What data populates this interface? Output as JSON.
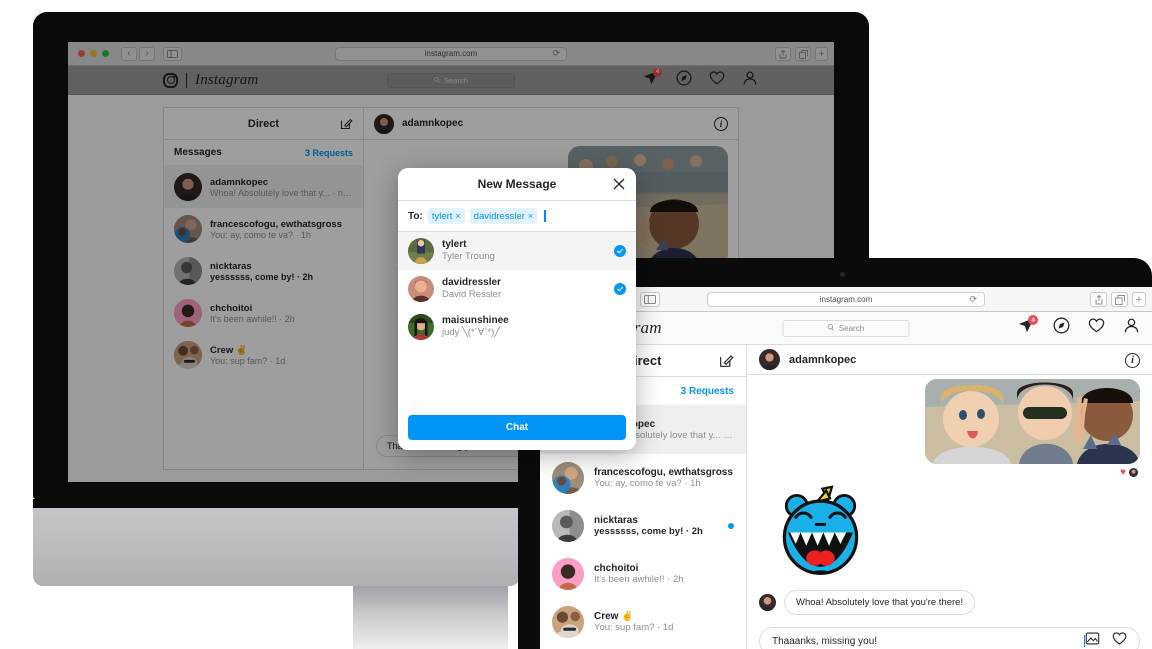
{
  "scene": {
    "description": "Instagram Direct web UI shown on an iMac desktop and a MacBook laptop",
    "accent_blue": "#0095f6",
    "badge_red": "#ed4956",
    "heart_red": "#ed4956"
  },
  "browser": {
    "url": "instagram.com",
    "traffic_lights": [
      "#ff5f57",
      "#febc2e",
      "#28c840"
    ],
    "icons": {
      "back": "‹",
      "forward": "›",
      "sidebar": "sidebar-icon",
      "reload": "⟳",
      "share": "share-icon",
      "tabs": "tabs-icon",
      "newtab": "+"
    }
  },
  "instagram_nav": {
    "wordmark": "Instagram",
    "search_placeholder": "Search",
    "search_icon": "search-icon",
    "notification_badge": "4",
    "icons": {
      "activity": "paper-plane-icon",
      "explore": "compass-icon",
      "likes": "heart-icon",
      "profile": "person-icon"
    }
  },
  "direct": {
    "header_title": "Direct",
    "compose_icon": "compose-icon",
    "messages_label": "Messages",
    "requests_label": "3 Requests",
    "threads": [
      {
        "name": "adamnkopec",
        "preview": "Whoa! Absolutely love that y... · now",
        "active": true,
        "unread": false,
        "avatar_colors": [
          "#3a2f2a",
          "#6b5547"
        ]
      },
      {
        "name": "francescofogu, ewthatsgross",
        "preview": "You: ay, como te va? · 1h",
        "active": false,
        "unread": false,
        "avatar_colors": [
          "#8a7a6a",
          "#2f7fbf"
        ]
      },
      {
        "name": "nicktaras",
        "preview": "yessssss, come by! · 2h",
        "active": false,
        "unread": true,
        "avatar_colors": [
          "#9a9a9a",
          "#4a4a4a"
        ]
      },
      {
        "name": "chchoitoi",
        "preview": "It's been awhile!! · 2h",
        "active": false,
        "unread": false,
        "avatar_colors": [
          "#ff9ec4",
          "#c9547f"
        ]
      },
      {
        "name": "Crew ✌️",
        "preview": "You: sup fam? · 1d",
        "active": false,
        "unread": false,
        "avatar_colors": [
          "#d8b08c",
          "#9e8470"
        ]
      }
    ]
  },
  "conversation": {
    "username": "adamnkopec",
    "info_icon": "info-icon",
    "info_glyph": "i",
    "photo_alt": "beach-selfie-photo",
    "reaction_heart": "♥",
    "sticker_alt": "blue-monster-sticker",
    "incoming_message": "Whoa! Absolutely love that you're there!",
    "composer_text": "Thaaanks, missing you!",
    "composer_icons": {
      "photo": "photo-icon",
      "like": "heart-icon"
    }
  },
  "modal": {
    "title": "New Message",
    "close_icon": "close-icon",
    "to_label": "To:",
    "chips": [
      {
        "label": "tylert",
        "remove": "×"
      },
      {
        "label": "davidressler",
        "remove": "×"
      }
    ],
    "results": [
      {
        "username": "tylert",
        "fullname": "Tyler Troung",
        "selected": true,
        "avatar_colors": [
          "#3b5a2a",
          "#8aa36b"
        ]
      },
      {
        "username": "davidressler",
        "fullname": "David Ressler",
        "selected": true,
        "avatar_colors": [
          "#c98b7a",
          "#8a4a3a"
        ]
      },
      {
        "username": "maisunshinee",
        "fullname": "judy ╲(*´∀`*)╱",
        "selected": false,
        "avatar_colors": [
          "#3f6b2a",
          "#1f3d16"
        ]
      }
    ],
    "check_glyph": "✓",
    "submit_label": "Chat"
  }
}
